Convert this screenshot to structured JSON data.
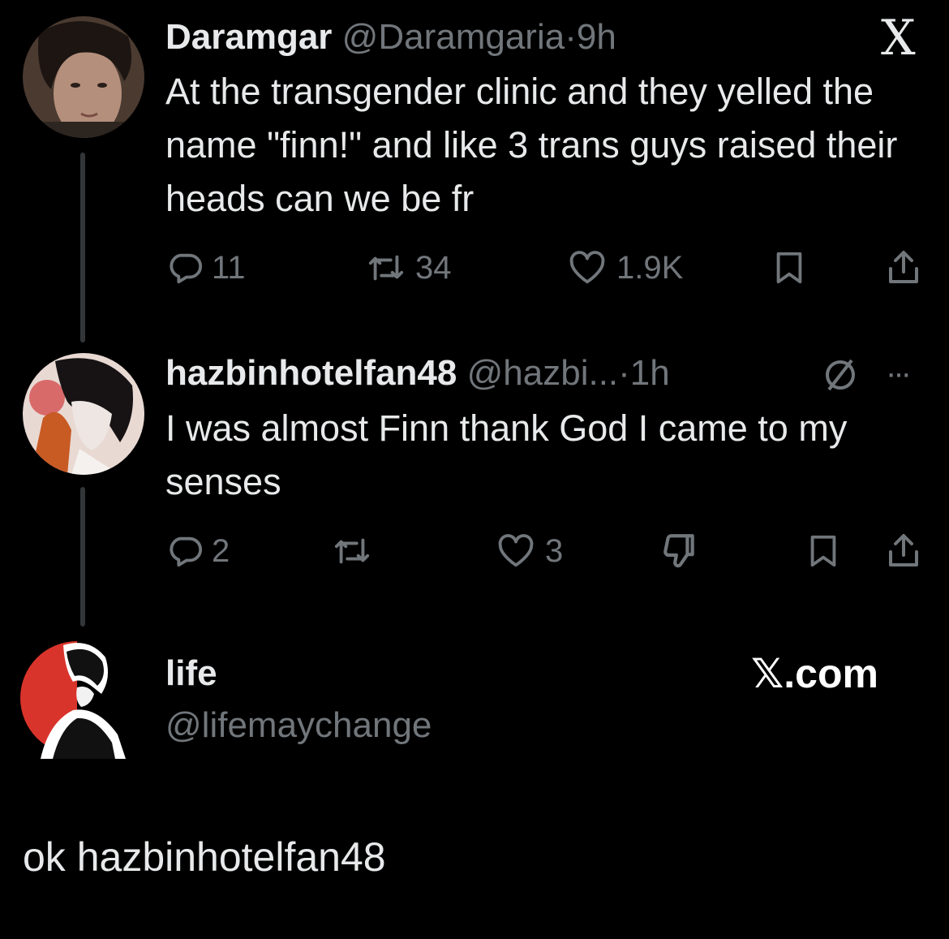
{
  "tweet1": {
    "display_name": "Daramgar",
    "handle": "@Daramgaria",
    "separator": "·",
    "time": "9h",
    "text": "At the transgender clinic and they yelled the name \"finn!\" and like 3 trans guys raised their heads can we be fr",
    "replies": "11",
    "reposts": "34",
    "likes": "1.9K",
    "close_logo": "X"
  },
  "tweet2": {
    "display_name": "hazbinhotelfan48",
    "handle": "@hazbi...",
    "separator": "·",
    "time": "1h",
    "more": "···",
    "text": "I was almost Finn thank God I came to my senses",
    "replies": "2",
    "likes": "3"
  },
  "card": {
    "display_name": "life",
    "handle": "@lifemaychange",
    "brand": "𝕏.com"
  },
  "caption": "ok hazbinhotelfan48",
  "colors": {
    "background": "#000000",
    "primary_text": "#e7e9ea",
    "secondary_text": "#71767b",
    "thread_line": "#333639",
    "avatar_red": "#d9342b"
  },
  "icons": [
    "reply-icon",
    "repost-icon",
    "like-icon",
    "bookmark-icon",
    "share-icon",
    "dislike-icon",
    "muted-circle-icon"
  ]
}
